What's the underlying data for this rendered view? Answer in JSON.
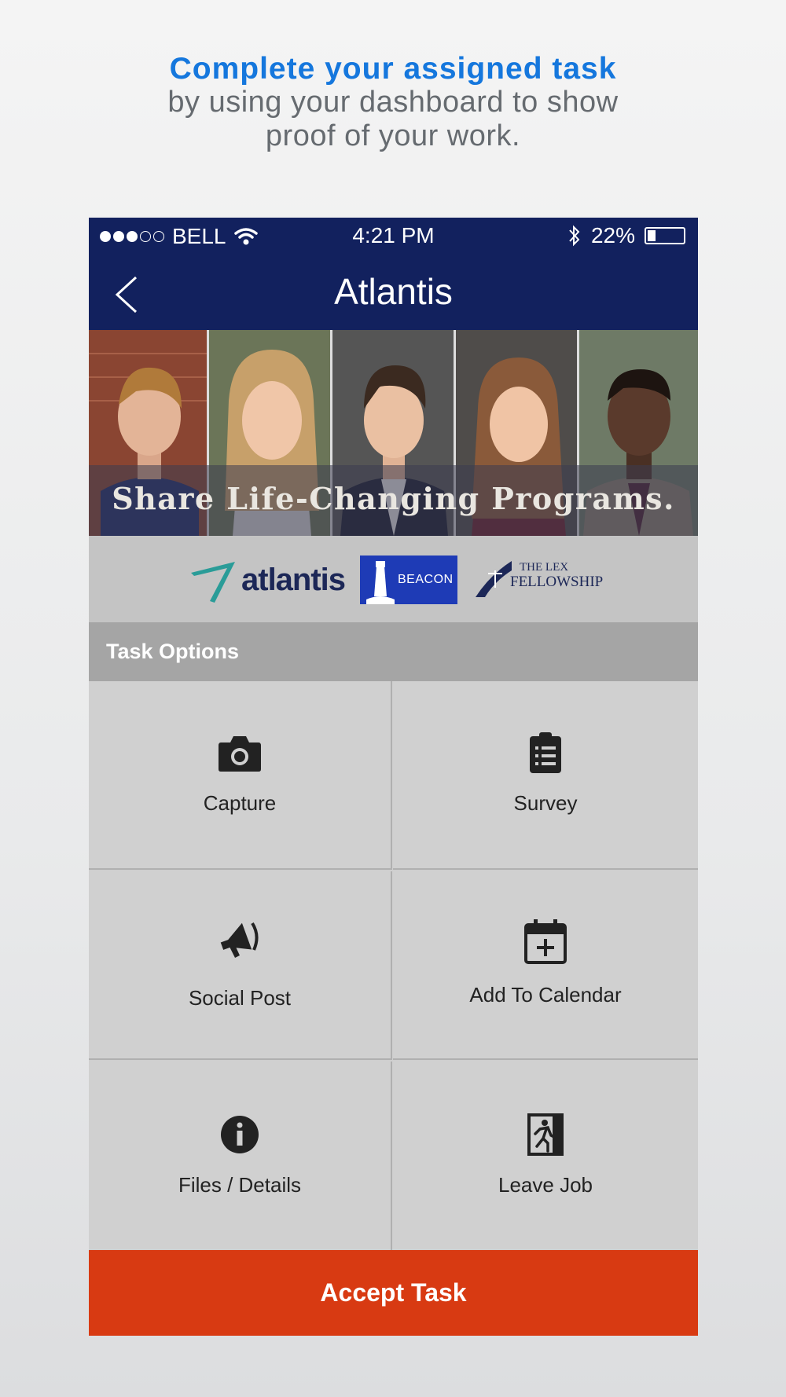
{
  "promo": {
    "headline": "Complete your assigned task",
    "line2": "by using your dashboard to show",
    "line3": "proof of your work."
  },
  "status_bar": {
    "carrier": "BELL",
    "time": "4:21 PM",
    "battery": "22%",
    "battery_level": 0.22,
    "signal_filled": 3,
    "signal_total": 5
  },
  "nav": {
    "title": "Atlantis"
  },
  "banner": {
    "tagline": "Share Life-Changing Programs."
  },
  "logos": {
    "atlantis": "atlantis",
    "beacon": "BEACON",
    "lex_line1": "THE LEX",
    "lex_line2": "FELLOWSHIP"
  },
  "task_options": {
    "title": "Task Options",
    "items": [
      {
        "label": "Capture",
        "icon": "camera-icon"
      },
      {
        "label": "Survey",
        "icon": "clipboard-list-icon"
      },
      {
        "label": "Social Post",
        "icon": "megaphone-icon"
      },
      {
        "label": "Add To Calendar",
        "icon": "calendar-plus-icon"
      },
      {
        "label": "Files / Details",
        "icon": "info-icon"
      },
      {
        "label": "Leave Job",
        "icon": "exit-door-icon"
      }
    ]
  },
  "accept_button": {
    "label": "Accept Task"
  },
  "colors": {
    "nav": "#12215e",
    "accept": "#d83a12",
    "headline": "#1577dd"
  }
}
